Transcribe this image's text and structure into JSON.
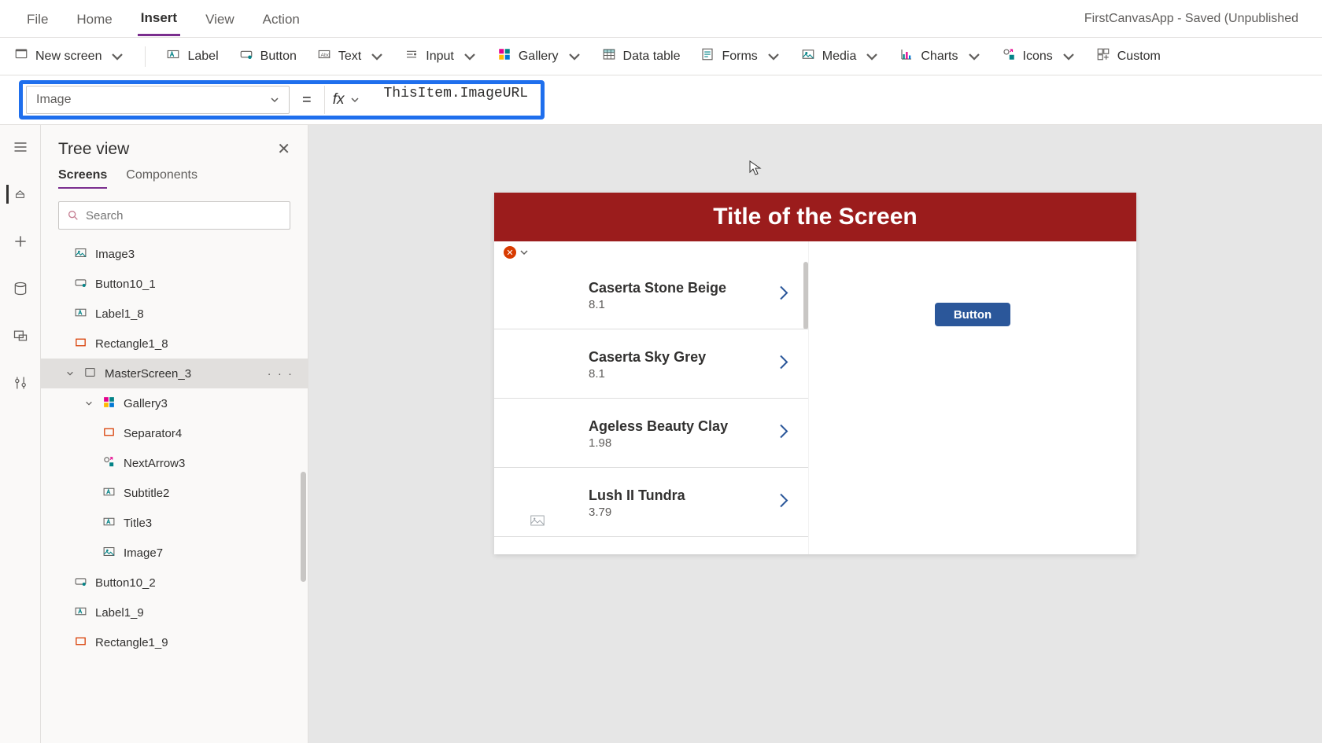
{
  "window_title": "FirstCanvasApp - Saved (Unpublished",
  "top_menu": {
    "file": "File",
    "home": "Home",
    "insert": "Insert",
    "view": "View",
    "action": "Action"
  },
  "ribbon": {
    "new_screen": "New screen",
    "label": "Label",
    "button": "Button",
    "text": "Text",
    "input": "Input",
    "gallery": "Gallery",
    "data_table": "Data table",
    "forms": "Forms",
    "media": "Media",
    "charts": "Charts",
    "icons": "Icons",
    "custom": "Custom"
  },
  "formula_bar": {
    "property": "Image",
    "equals": "=",
    "fx": "fx",
    "formula": "ThisItem.ImageURL"
  },
  "tree": {
    "title": "Tree view",
    "close": "✕",
    "tabs": {
      "screens": "Screens",
      "components": "Components"
    },
    "search_placeholder": "Search",
    "nodes": [
      {
        "label": "Image3",
        "type": "image",
        "indent": 1
      },
      {
        "label": "Button10_1",
        "type": "button",
        "indent": 1
      },
      {
        "label": "Label1_8",
        "type": "label",
        "indent": 1
      },
      {
        "label": "Rectangle1_8",
        "type": "rect",
        "indent": 1
      },
      {
        "label": "MasterScreen_3",
        "type": "screen",
        "indent": 2,
        "selected": true,
        "expanded": true,
        "more": "· · ·"
      },
      {
        "label": "Gallery3",
        "type": "gallery",
        "indent": 3,
        "expanded": true
      },
      {
        "label": "Separator4",
        "type": "rect",
        "indent": 4
      },
      {
        "label": "NextArrow3",
        "type": "icons",
        "indent": 4
      },
      {
        "label": "Subtitle2",
        "type": "label",
        "indent": 4
      },
      {
        "label": "Title3",
        "type": "label",
        "indent": 4
      },
      {
        "label": "Image7",
        "type": "image",
        "indent": 4
      },
      {
        "label": "Button10_2",
        "type": "button",
        "indent": 1
      },
      {
        "label": "Label1_9",
        "type": "label",
        "indent": 1
      },
      {
        "label": "Rectangle1_9",
        "type": "rect",
        "indent": 1
      }
    ]
  },
  "canvas": {
    "screen_title": "Title of the Screen",
    "button_label": "Button",
    "gallery_items": [
      {
        "title": "Caserta Stone Beige",
        "sub": "8.1"
      },
      {
        "title": "Caserta Sky Grey",
        "sub": "8.1"
      },
      {
        "title": "Ageless Beauty Clay",
        "sub": "1.98"
      },
      {
        "title": "Lush II Tundra",
        "sub": "3.79"
      }
    ]
  }
}
